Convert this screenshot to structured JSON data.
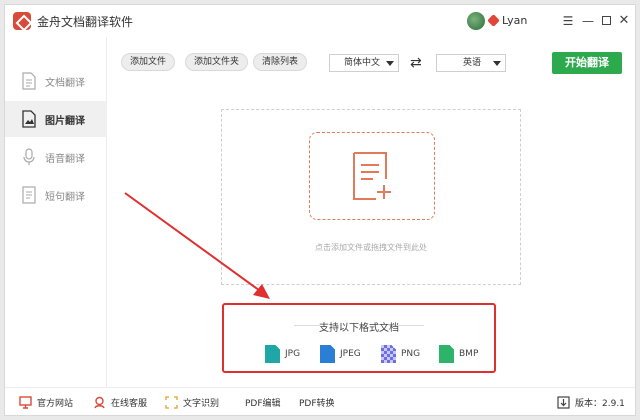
{
  "app": {
    "title": "金舟文档翻译软件",
    "user_name": "Lyan",
    "window_controls": [
      "menu-icon",
      "minimize-icon",
      "maximize-icon",
      "close-icon"
    ]
  },
  "colors": {
    "accent_green": "#2eaa4e",
    "highlight_red": "#e02f2f",
    "logo_red": "#d94a3a",
    "add_box_orange": "#e07a5a"
  },
  "sidebar": {
    "items": [
      {
        "label": "文档翻译",
        "icon": "document-icon",
        "active": false
      },
      {
        "label": "图片翻译",
        "icon": "image-icon",
        "active": true
      },
      {
        "label": "语音翻译",
        "icon": "microphone-icon",
        "active": false
      },
      {
        "label": "短句翻译",
        "icon": "text-icon",
        "active": false
      }
    ]
  },
  "toolbar": {
    "add_file": "添加文件",
    "add_folder": "添加文件夹",
    "clear_list": "清除列表",
    "source_lang": "简体中文",
    "target_lang": "英语",
    "swap_icon": "swap-arrows-icon",
    "start": "开始翻译"
  },
  "drop_zone": {
    "hint": "点击添加文件或拖拽文件到此处",
    "icon": "add-file-icon"
  },
  "formats": {
    "title": "支持以下格式文档",
    "items": [
      {
        "label": "JPG",
        "color": "#1fa6a6"
      },
      {
        "label": "JPEG",
        "color": "#2a7fd4"
      },
      {
        "label": "PNG",
        "color": "#6e6ee0"
      },
      {
        "label": "BMP",
        "color": "#2eb36a"
      }
    ]
  },
  "bottombar": {
    "website": "官方网站",
    "support": "在线客服",
    "ocr": "文字识别",
    "pdf_edit": "PDF编辑",
    "pdf_convert": "PDF转换",
    "version": "版本：2.9.1"
  }
}
